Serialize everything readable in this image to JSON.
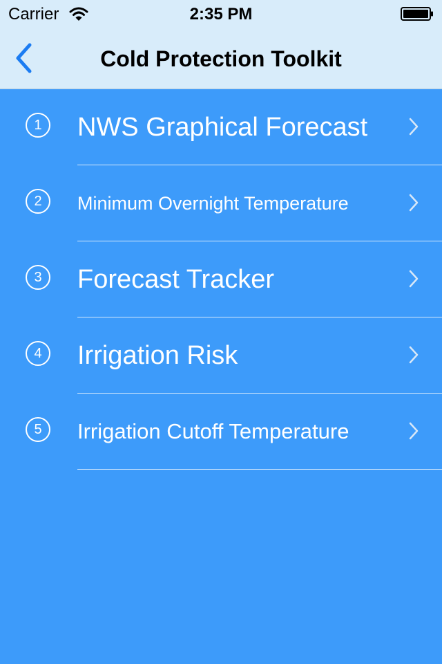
{
  "status_bar": {
    "carrier": "Carrier",
    "time": "2:35 PM"
  },
  "nav": {
    "title": "Cold Protection Toolkit",
    "back_icon": "chevron-left-icon"
  },
  "menu": [
    {
      "number": "1",
      "label": "NWS Graphical Forecast"
    },
    {
      "number": "2",
      "label": "Minimum Overnight Temperature"
    },
    {
      "number": "3",
      "label": "Forecast Tracker"
    },
    {
      "number": "4",
      "label": "Irrigation Risk"
    },
    {
      "number": "5",
      "label": "Irrigation Cutoff Temperature"
    }
  ],
  "colors": {
    "background": "#3d9bfa",
    "bar": "#d8ecfa",
    "accent": "#1b7cf2",
    "text_on_blue": "#ffffff"
  }
}
